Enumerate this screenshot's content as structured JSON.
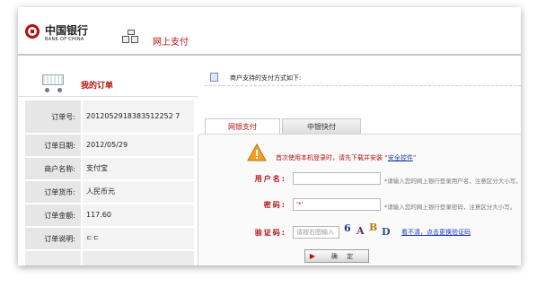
{
  "header": {
    "logo_cn": "中国银行",
    "logo_en": "BANK OF CHINA",
    "title": "网上支付"
  },
  "order": {
    "heading": "我的订单",
    "rows": [
      {
        "label": "订单号:",
        "value": "2012052918383512252 7"
      },
      {
        "label": "订单日期:",
        "value": "2012/05/29"
      },
      {
        "label": "商户名称:",
        "value": "支付宝"
      },
      {
        "label": "订单货币:",
        "value": "人民币元"
      },
      {
        "label": "订单金额:",
        "value": "117.60"
      },
      {
        "label": "订单说明:",
        "value": "ㄷㄷ"
      }
    ]
  },
  "payment": {
    "notice": "商户支持的支付方式如下:",
    "tabs": [
      {
        "label": "网银支付",
        "active": true
      },
      {
        "label": "中银快付",
        "active": false
      }
    ],
    "warning_text": "首次使用本机登录时，请先下载并安装 “",
    "warning_link": "安全控件",
    "warning_end": "”",
    "username_label": "用户名:",
    "username_hint": "*请输入您的网上银行登录用户名，注意区分大小写。",
    "password_label": "密码:",
    "password_value": "'*'",
    "password_hint": "*请输入您的网上银行登录密码，注意区分大小写。",
    "captcha_label": "验证码:",
    "captcha_placeholder": "请按右图输入",
    "captcha_chars": [
      "6",
      "A",
      "B",
      "D"
    ],
    "captcha_refresh": "看不清，点击更换验证码",
    "confirm_label": "确 定"
  },
  "colors": {
    "brand_red": "#b40f0f",
    "link_blue": "#1a37c2"
  }
}
